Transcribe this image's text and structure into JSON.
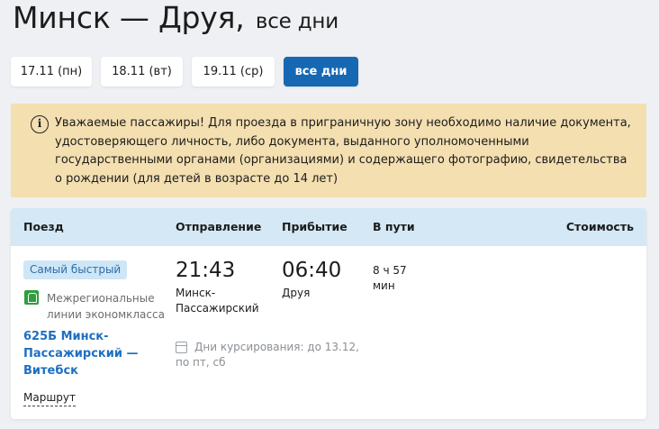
{
  "header": {
    "route": "Минск — Друя,",
    "subtitle": "все дни"
  },
  "days": [
    {
      "label": "17.11 (пн)",
      "active": false
    },
    {
      "label": "18.11 (вт)",
      "active": false
    },
    {
      "label": "19.11 (ср)",
      "active": false
    },
    {
      "label": "все дни",
      "active": true
    }
  ],
  "notice": {
    "icon": "info-icon",
    "text": "Уважаемые пассажиры! Для проезда в приграничную зону необходимо наличие документа, удостоверяющего личность, либо документа, выданного уполномоченными государственными органами (организациями) и содержащего фотографию, свидетельства о рождении (для детей в возрасте до 14 лет)"
  },
  "table": {
    "columns": {
      "train": "Поезд",
      "departure": "Отправление",
      "arrival": "Прибытие",
      "duration": "В пути",
      "price": "Стоимость"
    },
    "row": {
      "badge": "Самый быстрый",
      "carrier_icon": "train-carrier-icon",
      "carrier": "Межрегиональные линии экономкласса",
      "train": "625Б Минск-Пассажирский — Витебск",
      "route_link": "Маршрут",
      "departure_time": "21:43",
      "departure_station": "Минск-Пассажирский",
      "arrival_time": "06:40",
      "arrival_station": "Друя",
      "duration": "8 ч 57 мин",
      "schedule_icon": "calendar-icon",
      "schedule": "Дни курсирования: до 13.12, по пт, сб"
    }
  },
  "colors": {
    "accent": "#1768b2",
    "notice_bg": "#f4dfb1",
    "table_head_bg": "#d4e8f5",
    "link": "#1e6fc0"
  }
}
